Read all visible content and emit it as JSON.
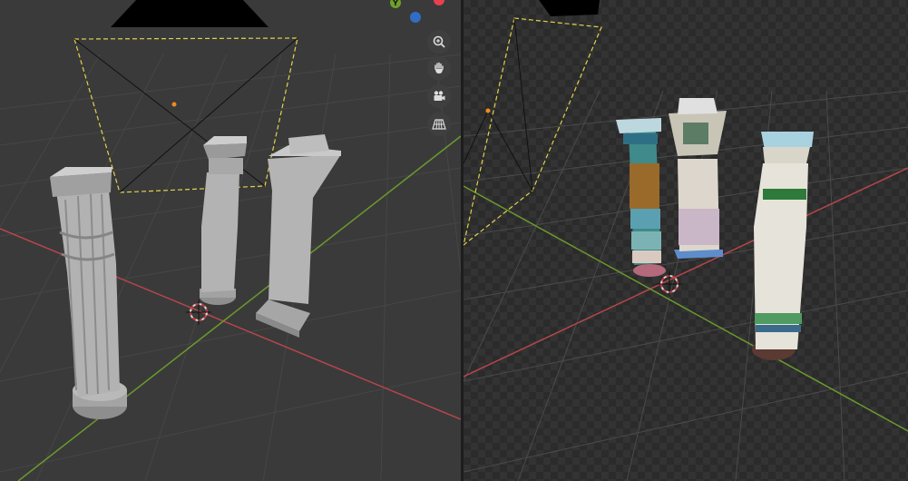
{
  "gizmo": {
    "y_label": "Y",
    "y_color": "#6ea02a",
    "x_color": "#e8404f",
    "z_color": "#2f6ec4"
  },
  "colors": {
    "x_axis": "#b8464c",
    "y_axis": "#6b9a2d",
    "camera_frame": "#e3d24b",
    "selected_origin": "#f08a1e",
    "clay": "#b4b4b4"
  },
  "nav_tools": [
    {
      "icon": "zoom-icon"
    },
    {
      "icon": "hand-pan-icon"
    },
    {
      "icon": "camera-view-icon"
    },
    {
      "icon": "grid-perspective-icon"
    }
  ],
  "viewports": {
    "left": {
      "shading": "solid"
    },
    "right": {
      "shading": "material-preview"
    }
  }
}
